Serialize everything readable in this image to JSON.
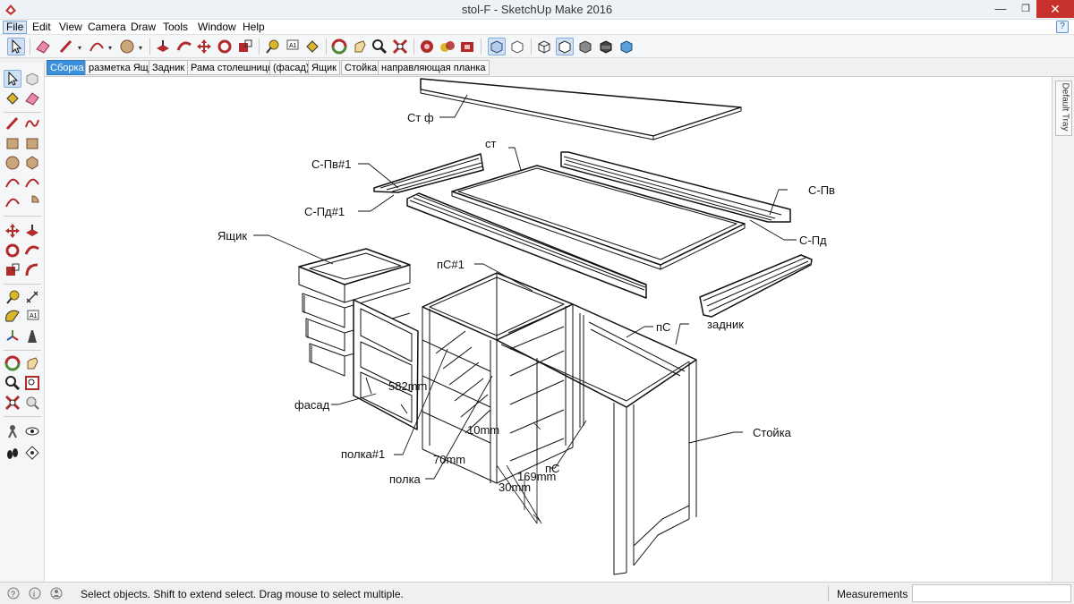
{
  "window": {
    "title": "stol-F - SketchUp Make 2016",
    "min_glyph": "—",
    "max_glyph": "❐",
    "close_glyph": "✕"
  },
  "menu": {
    "file": "File",
    "edit": "Edit",
    "view": "View",
    "camera": "Camera",
    "draw": "Draw",
    "tools": "Tools",
    "window": "Window",
    "help": "Help",
    "help_glyph": "?"
  },
  "scenes": [
    {
      "label": "Сборка"
    },
    {
      "label": "разметка Ящ"
    },
    {
      "label": "Задник"
    },
    {
      "label": "Рама столешницы"
    },
    {
      "label": "(фасад)"
    },
    {
      "label": "Ящик"
    },
    {
      "label": "Стойка"
    },
    {
      "label": "направляющая планка"
    }
  ],
  "tray": {
    "label": "Default Tray"
  },
  "drawing": {
    "labels": {
      "st_f": "Ст ф",
      "st": "ст",
      "s_pv1": "С-Пв#1",
      "s_pd1": "С-Пд#1",
      "s_pv": "С-Пв",
      "s_pd": "С-Пд",
      "yashchik": "Ящик",
      "ps1": "пС#1",
      "ps": "пС",
      "zadnik": "задник",
      "fasad": "фасад",
      "stoyka": "Стойка",
      "polka1": "полка#1",
      "polka": "полка",
      "ps_lower": "пС"
    },
    "dims": {
      "d1": "582mm",
      "d2": "10mm",
      "d3": "70mm",
      "d4": "169mm",
      "d5": "30mm"
    }
  },
  "status": {
    "hint": "Select objects. Shift to extend select. Drag mouse to select multiple.",
    "measurements_label": "Measurements",
    "measurements_value": ""
  },
  "colors": {
    "accent": "#3b8fdb",
    "close": "#c7312b",
    "tool_red": "#b22a2a",
    "tool_yellow": "#d9b62a",
    "tool_green": "#4d8a34"
  }
}
